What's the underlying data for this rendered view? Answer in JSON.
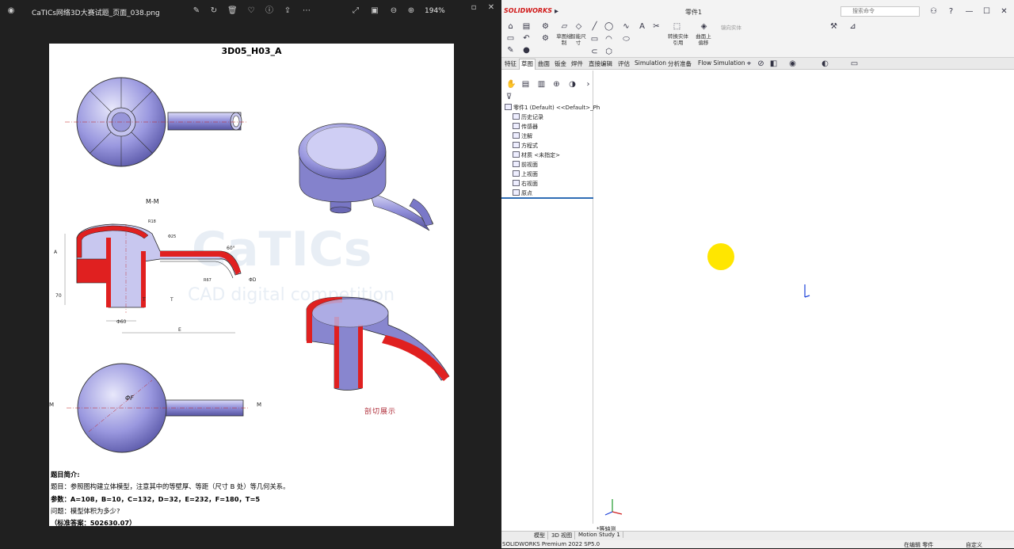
{
  "viewer": {
    "filename": "CaTICs网络3D大赛试题_页面_038.png",
    "zoom": "194%",
    "page": {
      "title": "3D05_H03_A",
      "section_label": "M-M",
      "cut_label": "剖切展示",
      "m_left": "M",
      "m_right": "M",
      "watermark": "CaTICs",
      "watermark_sub": "CAD digital competition",
      "lines": [
        "题目简介:",
        "题目：参照图构建立体模型，注意其中的等壁厚、等距（尺寸 B 处）等几何关系。",
        "参数：A=108，B=10，C=132，D=32，E=232，F=180，T=5",
        "问题：模型体积为多少?",
        "（标准答案：502630.07）"
      ]
    }
  },
  "solidworks": {
    "logo": "SOLIDWORKS",
    "doc_title": "零件1",
    "search_placeholder": "搜索命令",
    "toolbar": {
      "sketch": "草图绘制",
      "dim": "智能尺寸",
      "convert": "转换实体引用",
      "surface": "曲面上偏移",
      "mirror": "镜向实体"
    },
    "tabs": [
      "特征",
      "草图",
      "曲面",
      "钣金",
      "焊件",
      "直接编辑",
      "评估",
      "Simulation",
      "分析准备",
      "Flow Simulation"
    ],
    "active_tab": "草图",
    "tree": [
      "零件1 (Default) <<Default>_Ph",
      "历史记录",
      "传感器",
      "注解",
      "方程式",
      "材质 <未指定>",
      "前视面",
      "上视面",
      "右视面",
      "原点"
    ],
    "view_label": "*等轴测",
    "bottom_tabs": [
      "模型",
      "3D 视图",
      "Motion Study 1"
    ],
    "status_left": "SOLIDWORKS Premium 2022 SP5.0",
    "status_mid": "在编辑 零件",
    "status_right": "自定义"
  },
  "colors": {
    "accent": "#2f6db5",
    "cursor": "#ffe600",
    "part": "#8c8ad8",
    "section": "#e02020"
  }
}
